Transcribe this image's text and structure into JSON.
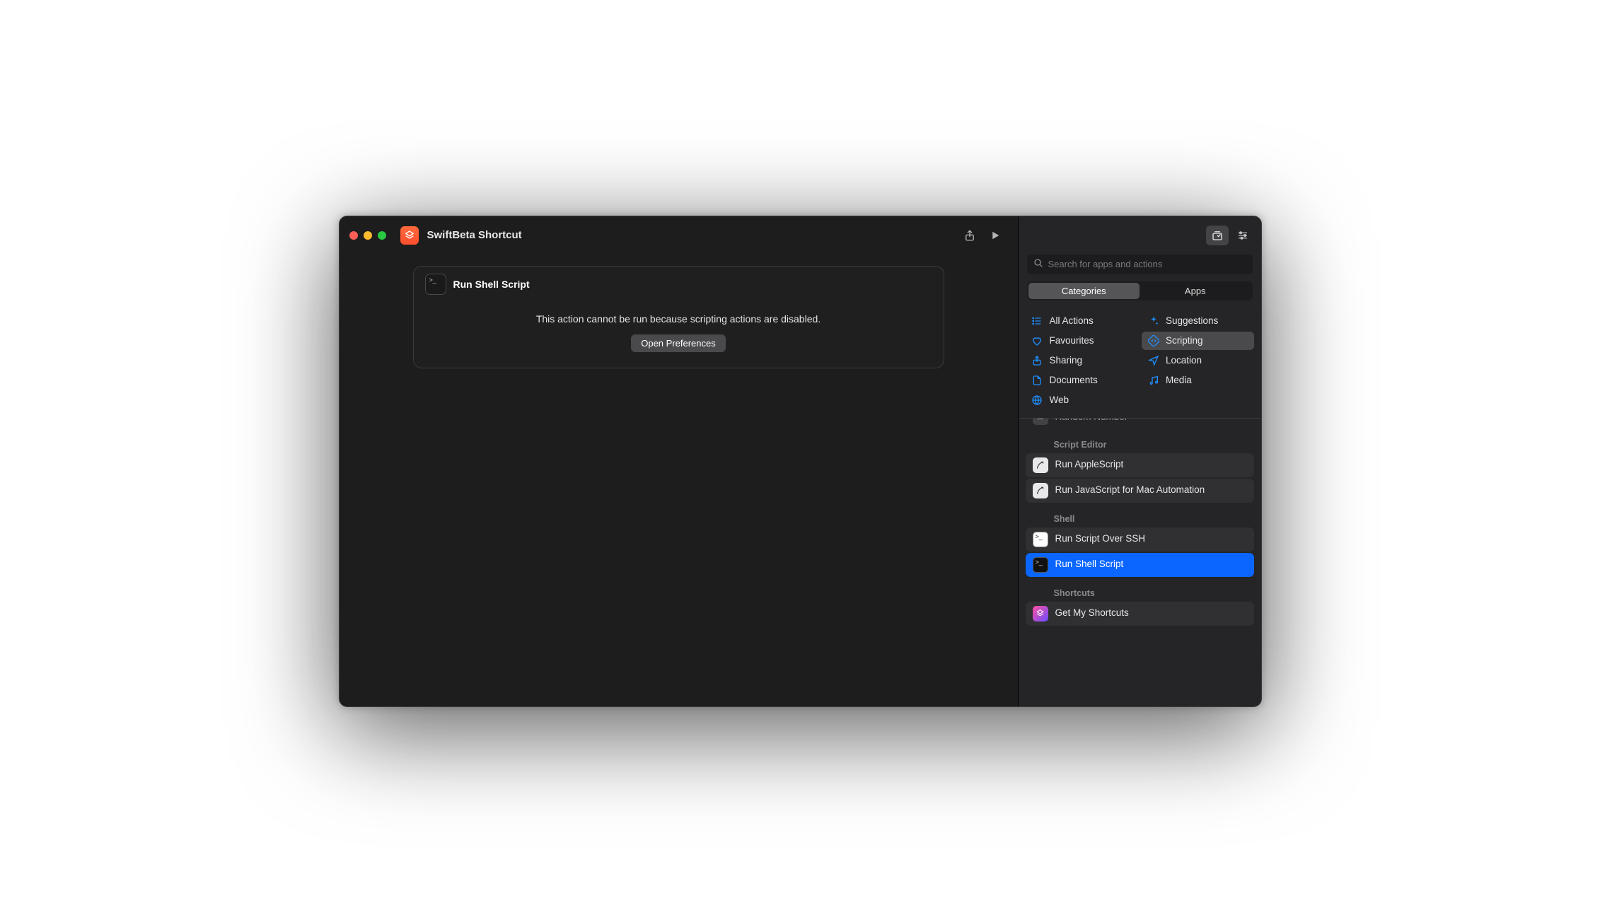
{
  "window": {
    "title": "SwiftBeta Shortcut"
  },
  "action_card": {
    "title": "Run Shell Script",
    "message": "This action cannot be run because scripting actions are disabled.",
    "button": "Open Preferences"
  },
  "sidebar": {
    "search_placeholder": "Search for apps and actions",
    "tabs": {
      "categories": "Categories",
      "apps": "Apps"
    },
    "categories": [
      {
        "key": "all",
        "label": "All Actions"
      },
      {
        "key": "suggestions",
        "label": "Suggestions"
      },
      {
        "key": "favourites",
        "label": "Favourites"
      },
      {
        "key": "scripting",
        "label": "Scripting"
      },
      {
        "key": "sharing",
        "label": "Sharing"
      },
      {
        "key": "location",
        "label": "Location"
      },
      {
        "key": "documents",
        "label": "Documents"
      },
      {
        "key": "media",
        "label": "Media"
      },
      {
        "key": "web",
        "label": "Web"
      }
    ],
    "selected_category": "scripting",
    "peek_item": "Random Number",
    "groups": [
      {
        "name": "Script Editor",
        "items": [
          {
            "label": "Run AppleScript",
            "icon": "script"
          },
          {
            "label": "Run JavaScript for Mac Automation",
            "icon": "script"
          }
        ]
      },
      {
        "name": "Shell",
        "items": [
          {
            "label": "Run Script Over SSH",
            "icon": "terminal-white"
          },
          {
            "label": "Run Shell Script",
            "icon": "terminal-dark",
            "selected": true
          }
        ]
      },
      {
        "name": "Shortcuts",
        "items": [
          {
            "label": "Get My Shortcuts",
            "icon": "shortcuts"
          }
        ]
      }
    ]
  }
}
